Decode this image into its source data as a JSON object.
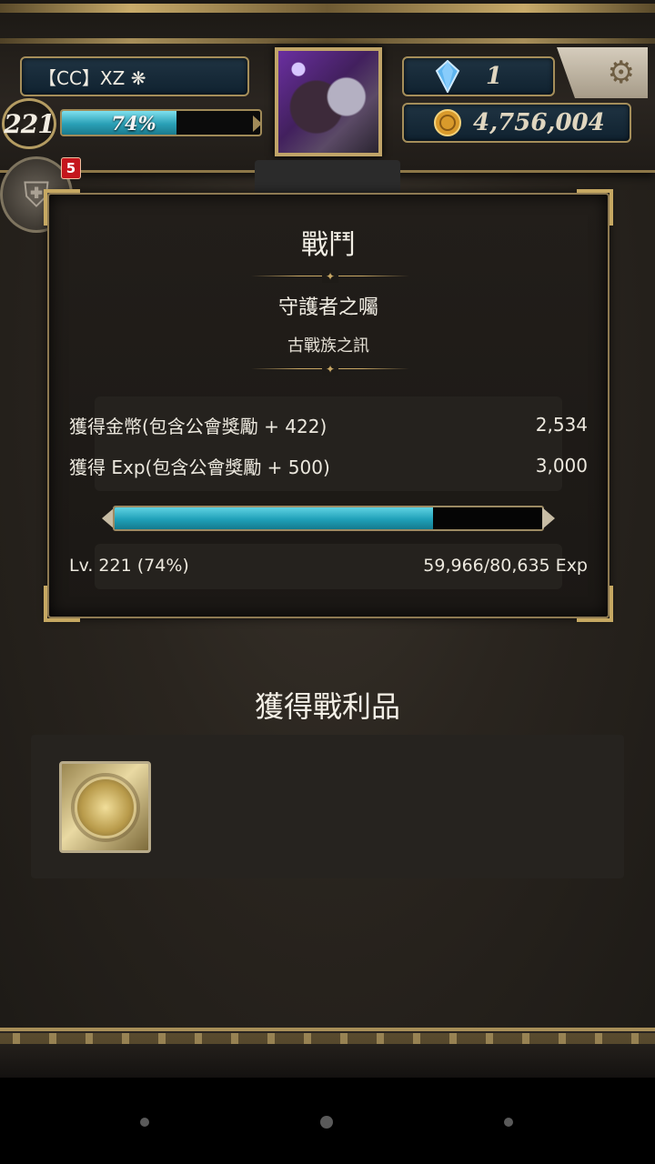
{
  "header": {
    "player_name": "【CC】XZ ❋",
    "level": "221",
    "exp_percent_label": "74%",
    "exp_fraction": 0.74,
    "gem_count": "1",
    "gold_count": "4,756,004",
    "notification_badge": "5",
    "icons": {
      "gem": "blue-crystal-icon",
      "gold": "gold-coin-icon",
      "settings": "gear-icon",
      "menu": "shield-icon"
    }
  },
  "battle": {
    "title": "戰鬥",
    "quest_name": "守護者之囑",
    "quest_subtitle": "古戰族之訊",
    "gold_label": "獲得金幣(包含公會獎勵 + 422)",
    "gold_value": "2,534",
    "exp_label": "獲得 Exp(包含公會獎勵 + 500)",
    "exp_value": "3,000",
    "level_label": "Lv. 221 (74%)",
    "exp_progress": "59,966/80,635 Exp",
    "exp_fraction": 0.7437
  },
  "loot": {
    "title": "獲得戰利品",
    "items": [
      "gold-coin-card"
    ]
  },
  "colors": {
    "accent_gold": "#c6a862",
    "exp_fill": "#1fa0b8",
    "badge_red": "#c4161c"
  }
}
